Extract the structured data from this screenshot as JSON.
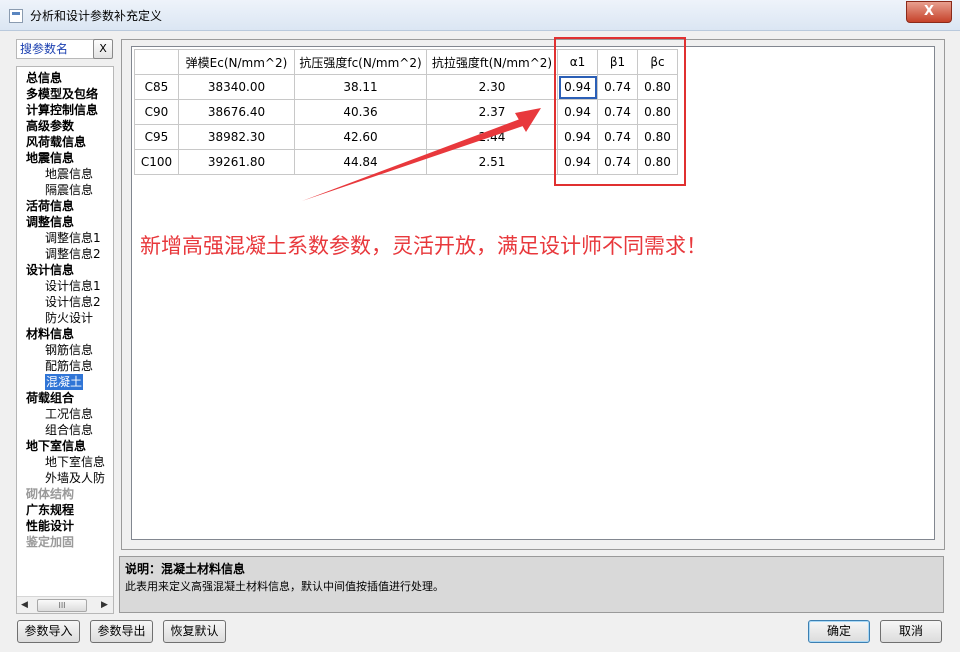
{
  "window": {
    "title": "分析和设计参数补充定义",
    "close_symbol": "X"
  },
  "search": {
    "label": "搜参数名",
    "clear_label": "X"
  },
  "tree": [
    {
      "label": "总信息",
      "level": 1,
      "state": "normal"
    },
    {
      "label": "多模型及包络",
      "level": 1,
      "state": "normal"
    },
    {
      "label": "计算控制信息",
      "level": 1,
      "state": "normal"
    },
    {
      "label": "高级参数",
      "level": 1,
      "state": "normal"
    },
    {
      "label": "风荷载信息",
      "level": 1,
      "state": "normal"
    },
    {
      "label": "地震信息",
      "level": 1,
      "state": "normal"
    },
    {
      "label": "地震信息",
      "level": 2,
      "state": "normal"
    },
    {
      "label": "隔震信息",
      "level": 2,
      "state": "normal"
    },
    {
      "label": "活荷信息",
      "level": 1,
      "state": "normal"
    },
    {
      "label": "调整信息",
      "level": 1,
      "state": "normal"
    },
    {
      "label": "调整信息1",
      "level": 2,
      "state": "normal"
    },
    {
      "label": "调整信息2",
      "level": 2,
      "state": "normal"
    },
    {
      "label": "设计信息",
      "level": 1,
      "state": "normal"
    },
    {
      "label": "设计信息1",
      "level": 2,
      "state": "normal"
    },
    {
      "label": "设计信息2",
      "level": 2,
      "state": "normal"
    },
    {
      "label": "防火设计",
      "level": 2,
      "state": "normal"
    },
    {
      "label": "材料信息",
      "level": 1,
      "state": "normal"
    },
    {
      "label": "钢筋信息",
      "level": 2,
      "state": "normal"
    },
    {
      "label": "配筋信息",
      "level": 2,
      "state": "normal"
    },
    {
      "label": "混凝土",
      "level": 2,
      "state": "selected"
    },
    {
      "label": "荷载组合",
      "level": 1,
      "state": "normal"
    },
    {
      "label": "工况信息",
      "level": 2,
      "state": "normal"
    },
    {
      "label": "组合信息",
      "level": 2,
      "state": "normal"
    },
    {
      "label": "地下室信息",
      "level": 1,
      "state": "normal"
    },
    {
      "label": "地下室信息",
      "level": 2,
      "state": "normal"
    },
    {
      "label": "外墙及人防",
      "level": 2,
      "state": "normal"
    },
    {
      "label": "砌体结构",
      "level": 1,
      "state": "disabled"
    },
    {
      "label": "广东规程",
      "level": 1,
      "state": "normal"
    },
    {
      "label": "性能设计",
      "level": 1,
      "state": "normal"
    },
    {
      "label": "鉴定加固",
      "level": 1,
      "state": "disabled"
    }
  ],
  "scroll": {
    "left": "◀",
    "right": "▶",
    "grip": "III"
  },
  "grid": {
    "headers": [
      "",
      "弹模Ec(N/mm^2)",
      "抗压强度fc(N/mm^2)",
      "抗拉强度ft(N/mm^2)",
      "α1",
      "β1",
      "βc"
    ],
    "rows": [
      [
        "C85",
        "38340.00",
        "38.11",
        "2.30",
        "0.94",
        "0.74",
        "0.80"
      ],
      [
        "C90",
        "38676.40",
        "40.36",
        "2.37",
        "0.94",
        "0.74",
        "0.80"
      ],
      [
        "C95",
        "38982.30",
        "42.60",
        "2.44",
        "0.94",
        "0.74",
        "0.80"
      ],
      [
        "C100",
        "39261.80",
        "44.84",
        "2.51",
        "0.94",
        "0.74",
        "0.80"
      ]
    ]
  },
  "annotation": {
    "text": "新增高强混凝土系数参数，灵活开放，满足设计师不同需求！",
    "color": "#e8383c"
  },
  "description": {
    "title": "说明：混凝土材料信息",
    "text": "此表用来定义高强混凝土材料信息，默认中间值按插值进行处理。"
  },
  "buttons": {
    "import": "参数导入",
    "export": "参数导出",
    "restore": "恢复默认",
    "ok": "确定",
    "cancel": "取消"
  }
}
